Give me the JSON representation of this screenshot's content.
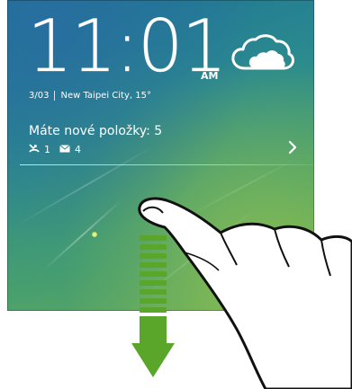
{
  "lockscreen": {
    "time": "11:01",
    "am_pm": "AM",
    "date": "3/03",
    "location_temp": "New Taipei City, 15°",
    "weather_icon": "cloudy-icon",
    "notification": {
      "title": "Máte nové položky: 5",
      "missed_calls_icon": "missed-call-icon",
      "missed_calls_count": "1",
      "mail_icon": "mail-icon",
      "mail_count": "4",
      "chevron_icon": "chevron-right-icon"
    }
  },
  "gesture": {
    "direction": "swipe-down",
    "arrow_color": "#5aa62a",
    "hand_icon": "finger-hand-icon"
  },
  "colors": {
    "wallpaper_top": "#1d6f97",
    "wallpaper_bottom": "#7db54d",
    "text": "#ffffff"
  }
}
